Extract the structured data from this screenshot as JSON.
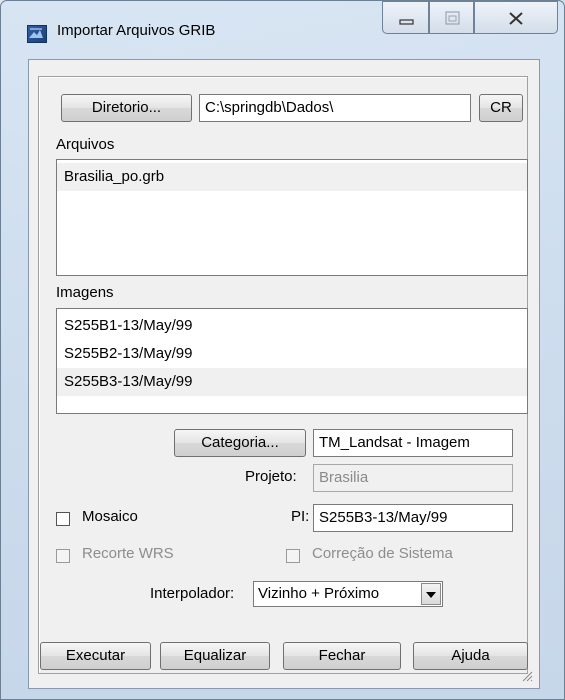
{
  "window": {
    "title": "Importar Arquivos GRIB"
  },
  "directory": {
    "button_label": "Diretorio...",
    "path": "C:\\springdb\\Dados\\",
    "cr_label": "CR"
  },
  "arquivos": {
    "label": "Arquivos",
    "items": [
      "Brasilia_po.grb"
    ]
  },
  "imagens": {
    "label": "Imagens",
    "items": [
      "S255B1-13/May/99",
      "S255B2-13/May/99",
      "S255B3-13/May/99"
    ],
    "selected_index": 2
  },
  "categoria": {
    "button_label": "Categoria...",
    "value": "TM_Landsat - Imagem"
  },
  "projeto": {
    "label": "Projeto:",
    "value": "Brasilia"
  },
  "mosaico": {
    "label": "Mosaico",
    "checked": false
  },
  "pi": {
    "label": "PI:",
    "value": "S255B3-13/May/99"
  },
  "recorte": {
    "label": "Recorte WRS",
    "checked": false,
    "enabled": false
  },
  "correcao": {
    "label": "Correção de Sistema",
    "checked": false,
    "enabled": false
  },
  "interpolador": {
    "label": "Interpolador:",
    "value": "Vizinho + Próximo"
  },
  "buttons": {
    "executar": "Executar",
    "equalizar": "Equalizar",
    "fechar": "Fechar",
    "ajuda": "Ajuda"
  },
  "icons": {
    "app": "grib-app-icon",
    "minimize": "minimize-icon",
    "maximize": "maximize-icon",
    "close": "close-icon",
    "dropdown": "chevron-down-icon",
    "grip": "resize-grip-icon"
  }
}
